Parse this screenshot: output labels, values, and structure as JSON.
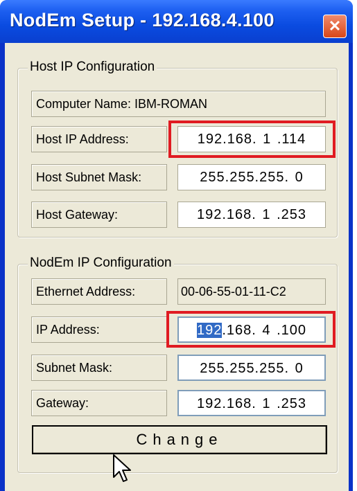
{
  "window": {
    "title": "NodEm Setup - 192.168.4.100"
  },
  "host": {
    "group_title": "Host IP Configuration",
    "computer_name": "Computer Name: IBM-ROMAN",
    "ip_label": "Host IP Address:",
    "ip_value": "192.168. 1 .114",
    "subnet_label": "Host Subnet Mask:",
    "subnet_value": "255.255.255. 0",
    "gateway_label": "Host Gateway:",
    "gateway_value": "192.168. 1 .253"
  },
  "nodem": {
    "group_title": "NodEm IP Configuration",
    "eth_label": "Ethernet Address:",
    "eth_value": "00-06-55-01-11-C2",
    "ip_label": "IP Address:",
    "ip_selected": "192",
    "ip_rest": ".168. 4 .100",
    "subnet_label": "Subnet Mask:",
    "subnet_value": "255.255.255. 0",
    "gateway_label": "Gateway:",
    "gateway_value": "192.168. 1 .253"
  },
  "change_button": "Change",
  "icons": {
    "close": "close-icon",
    "cursor": "mouse-pointer-icon"
  }
}
